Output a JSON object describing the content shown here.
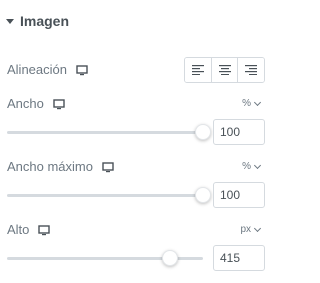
{
  "section": {
    "title": "Imagen",
    "collapse_icon": "caret-down-icon"
  },
  "alineacion": {
    "label": "Alineación",
    "device_icon": "desktop-monitor-icon",
    "options": [
      {
        "name": "align-left",
        "icon": "align-left-icon"
      },
      {
        "name": "align-center",
        "icon": "align-center-icon"
      },
      {
        "name": "align-right",
        "icon": "align-right-icon"
      }
    ]
  },
  "ancho": {
    "label": "Ancho",
    "device_icon": "desktop-monitor-icon",
    "unit": "%",
    "value": "100",
    "slider_fraction": 1.0
  },
  "ancho_maximo": {
    "label": "Ancho máximo",
    "device_icon": "desktop-monitor-icon",
    "unit": "%",
    "value": "100",
    "slider_fraction": 1.0
  },
  "alto": {
    "label": "Alto",
    "device_icon": "desktop-monitor-icon",
    "unit": "px",
    "value": "415",
    "slider_fraction": 0.83
  },
  "colors": {
    "text": "#6d7882",
    "heading": "#495157",
    "border": "#d5dadf",
    "track": "#d5dadf"
  }
}
